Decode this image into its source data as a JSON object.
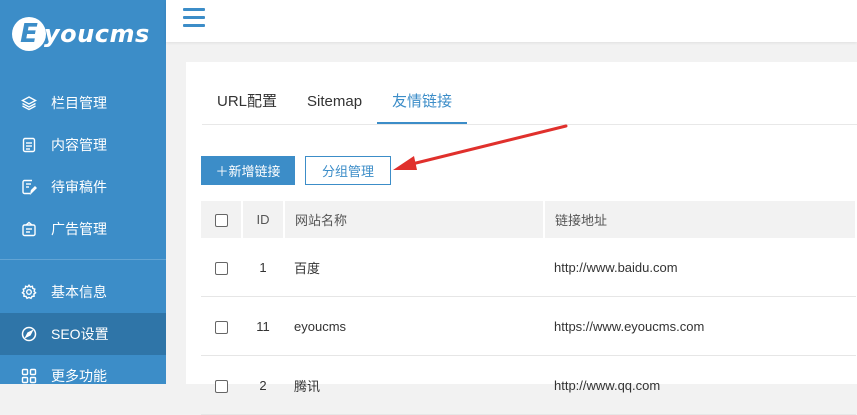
{
  "brand": {
    "logo_letter": "E",
    "logo_text": "youcms"
  },
  "sidebar": {
    "items": [
      {
        "label": "栏目管理",
        "icon": "layers-icon"
      },
      {
        "label": "内容管理",
        "icon": "document-icon"
      },
      {
        "label": "待审稿件",
        "icon": "edit-document-icon"
      },
      {
        "label": "广告管理",
        "icon": "ad-icon"
      },
      {
        "label": "基本信息",
        "icon": "gear-icon"
      },
      {
        "label": "SEO设置",
        "icon": "compass-icon"
      },
      {
        "label": "更多功能",
        "icon": "grid-icon"
      }
    ],
    "active_index": 5
  },
  "tabs": [
    {
      "label": "URL配置"
    },
    {
      "label": "Sitemap"
    },
    {
      "label": "友情链接"
    }
  ],
  "toolbar": {
    "add_label": "＋新增链接",
    "group_label": "分组管理"
  },
  "table": {
    "headers": {
      "id": "ID",
      "name": "网站名称",
      "url": "链接地址"
    },
    "rows": [
      {
        "id": "1",
        "name": "百度",
        "url": "http://www.baidu.com"
      },
      {
        "id": "11",
        "name": "eyoucms",
        "url": "https://www.eyoucms.com"
      },
      {
        "id": "2",
        "name": "腾讯",
        "url": "http://www.qq.com"
      }
    ]
  },
  "colors": {
    "accent": "#3c8dc8",
    "annotation_arrow": "#e0302c"
  }
}
